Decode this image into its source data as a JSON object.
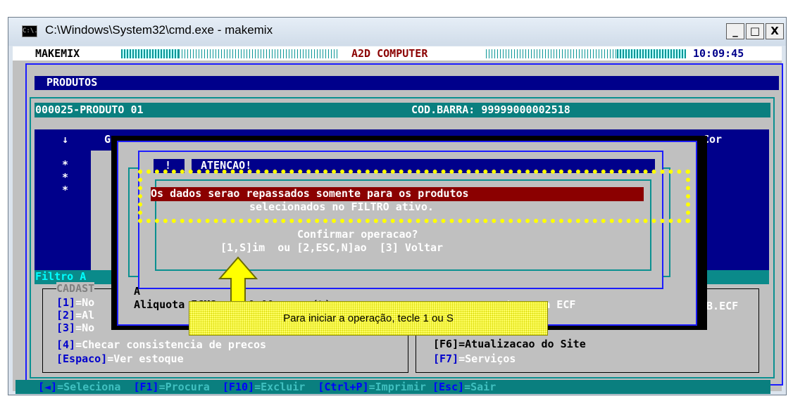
{
  "window": {
    "title": "C:\\Windows\\System32\\cmd.exe - makemix",
    "icon_label": "C:\\.",
    "minimize": "_",
    "maximize": "□",
    "close": "X"
  },
  "topline": {
    "app": "MAKEMIX",
    "company": "A2D COMPUTER",
    "time": "10:09:45"
  },
  "screen": {
    "section_title": "PRODUTOS",
    "product": "000025-PRODUTO 01",
    "barcode": "COD.BARRA: 99999000002518",
    "col_marker": "↓",
    "col_g": "G",
    "col_cor": "Cor",
    "asterisks": [
      "*",
      "*",
      "*"
    ],
    "filtro": "Filtro A",
    "cadast": "CADAST",
    "left_options": [
      {
        "key": "[1]",
        "text": "=No"
      },
      {
        "key": "[2]",
        "text": "=Al"
      },
      {
        "key": "[3]",
        "text": "=No"
      },
      {
        "key": "[4]",
        "text": "=Checar consistencia de precos"
      },
      {
        "key": "[Espaco]",
        "text": "=Ver estoque"
      }
    ],
    "right_options": [
      {
        "text": "ente para ECF"
      },
      {
        "text": "IB.ECF"
      },
      {
        "text": "[F6]=Atualizacao do Site"
      },
      {
        "key": "[F7]",
        "text": "=Serviços"
      }
    ],
    "aliq_text": "Aliquota ICMS     0,00      (%)",
    "a_letter": "A"
  },
  "modal": {
    "icon": "!",
    "title": "ATENCAO!",
    "line1": "Os dados serao repassados somente para os produtos",
    "line2": "selecionados no FILTRO ativo.",
    "confirm": "Confirmar operacao?",
    "options": "[1,S]im  ou [2,ESC,N]ao  [3] Voltar"
  },
  "callout": {
    "text": "Para iniciar a operação, tecle 1 ou S"
  },
  "bottombar": {
    "items": [
      {
        "key": "[◄]",
        "text": "=Seleciona"
      },
      {
        "key": "[F1]",
        "text": "=Procura"
      },
      {
        "key": "[F10]",
        "text": "=Excluir"
      },
      {
        "key": "[Ctrl+P]",
        "text": "=Imprimir"
      },
      {
        "key": "[Esc]",
        "text": "=Sair"
      }
    ]
  },
  "colors": {
    "console_bg": "#c0c0c0",
    "dark_blue": "#00008b",
    "teal": "#0a7f7f",
    "red": "#8b0000",
    "highlight_yellow": "#ffff00"
  }
}
